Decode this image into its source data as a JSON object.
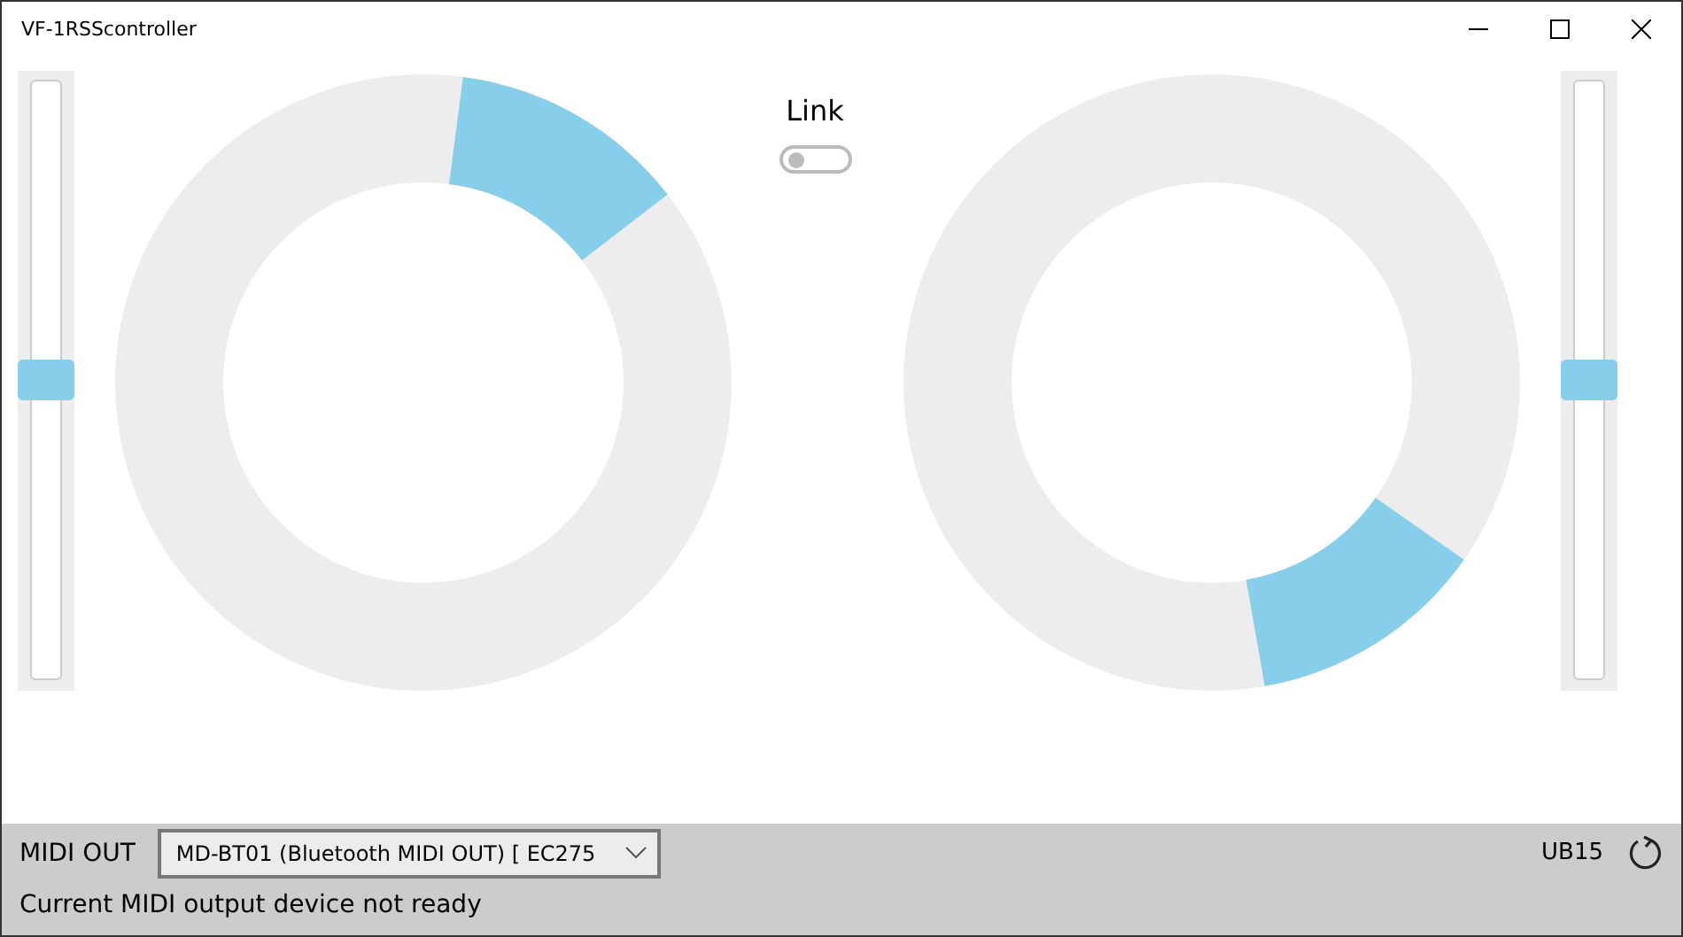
{
  "window": {
    "title": "VF-1RSScontroller"
  },
  "left_slider": {
    "level": 0.5
  },
  "link": {
    "label": "Link",
    "on": false
  },
  "right_slider": {
    "level": 0.5
  },
  "bottom_bar": {
    "label": "MIDI OUT",
    "device": "MD-BT01 (Bluetooth MIDI OUT) [ EC275",
    "model": "UB15",
    "status": "Current MIDI output device not ready"
  }
}
